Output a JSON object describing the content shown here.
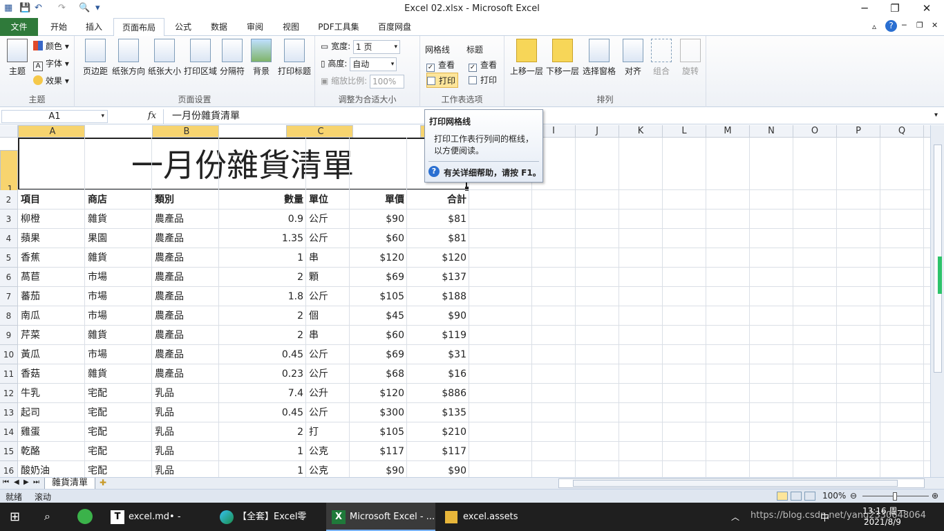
{
  "window": {
    "title": "Excel 02.xlsx - Microsoft Excel"
  },
  "ribbon_tabs": [
    "文件",
    "开始",
    "插入",
    "页面布局",
    "公式",
    "数据",
    "审阅",
    "视图",
    "PDF工具集",
    "百度网盘"
  ],
  "ribbon": {
    "theme": {
      "group": "主题",
      "main": "主题",
      "colors": "颜色",
      "fonts": "字体",
      "effects": "效果"
    },
    "page_setup": {
      "group": "页面设置",
      "buttons": [
        "页边距",
        "纸张方向",
        "纸张大小",
        "打印区域",
        "分隔符",
        "背景",
        "打印标题"
      ]
    },
    "fit": {
      "group": "调整为合适大小",
      "width_label": "宽度:",
      "width_value": "1 页",
      "height_label": "高度:",
      "height_value": "自动",
      "scale_label": "缩放比例:",
      "scale_value": "100%"
    },
    "sheet_options": {
      "group": "工作表选项",
      "gridlines": "网格线",
      "headings": "标题",
      "view": "查看",
      "print": "打印"
    },
    "arrange": {
      "group": "排列",
      "buttons": [
        "上移一层",
        "下移一层",
        "选择窗格",
        "对齐",
        "组合",
        "旋转"
      ]
    }
  },
  "formula_bar": {
    "name_box": "A1",
    "fx": "fx",
    "content": "一月份雜貨清單"
  },
  "tooltip": {
    "title": "打印网格线",
    "body": "打印工作表行列间的框线，以方便阅读。",
    "help": "有关详细帮助，请按 F1。"
  },
  "columns": [
    "A",
    "B",
    "C",
    "D",
    "E",
    "F",
    "G",
    "H",
    "I",
    "J",
    "K",
    "L",
    "M",
    "N",
    "O",
    "P",
    "Q",
    "R"
  ],
  "sheet": {
    "title": "一月份雜貨清單",
    "headers": [
      "項目",
      "商店",
      "類別",
      "數量",
      "單位",
      "單價",
      "合計"
    ],
    "rows": [
      [
        "柳橙",
        "雜貨",
        "農產品",
        "0.9",
        "公斤",
        "$90",
        "$81"
      ],
      [
        "蘋果",
        "果園",
        "農產品",
        "1.35",
        "公斤",
        "$60",
        "$81"
      ],
      [
        "香蕉",
        "雜貨",
        "農產品",
        "1",
        "串",
        "$120",
        "$120"
      ],
      [
        "萵苣",
        "市場",
        "農產品",
        "2",
        "顆",
        "$69",
        "$137"
      ],
      [
        "蕃茄",
        "市場",
        "農產品",
        "1.8",
        "公斤",
        "$105",
        "$188"
      ],
      [
        "南瓜",
        "市場",
        "農產品",
        "2",
        "個",
        "$45",
        "$90"
      ],
      [
        "芹菜",
        "雜貨",
        "農產品",
        "2",
        "串",
        "$60",
        "$119"
      ],
      [
        "黃瓜",
        "市場",
        "農產品",
        "0.45",
        "公斤",
        "$69",
        "$31"
      ],
      [
        "香菇",
        "雜貨",
        "農產品",
        "0.23",
        "公斤",
        "$68",
        "$16"
      ],
      [
        "牛乳",
        "宅配",
        "乳品",
        "7.4",
        "公升",
        "$120",
        "$886"
      ],
      [
        "起司",
        "宅配",
        "乳品",
        "0.45",
        "公斤",
        "$300",
        "$135"
      ],
      [
        "雞蛋",
        "宅配",
        "乳品",
        "2",
        "打",
        "$105",
        "$210"
      ],
      [
        "乾酪",
        "宅配",
        "乳品",
        "1",
        "公克",
        "$117",
        "$117"
      ],
      [
        "酸奶油",
        "宅配",
        "乳品",
        "1",
        "公克",
        "$90",
        "$90"
      ]
    ]
  },
  "sheet_tab": "雜貨清單",
  "status": {
    "ready": "就绪",
    "scroll": "滚动",
    "zoom": "100%"
  },
  "taskbar": {
    "apps": [
      "excel.md• - Typora",
      "【全套】Excel零基...",
      "Microsoft Excel - ...",
      "excel.assets"
    ],
    "time": "13:16 周一",
    "date": "2021/8/9",
    "watermark": "https://blog.csdn.net/yang2330648064",
    "ime": "中"
  }
}
